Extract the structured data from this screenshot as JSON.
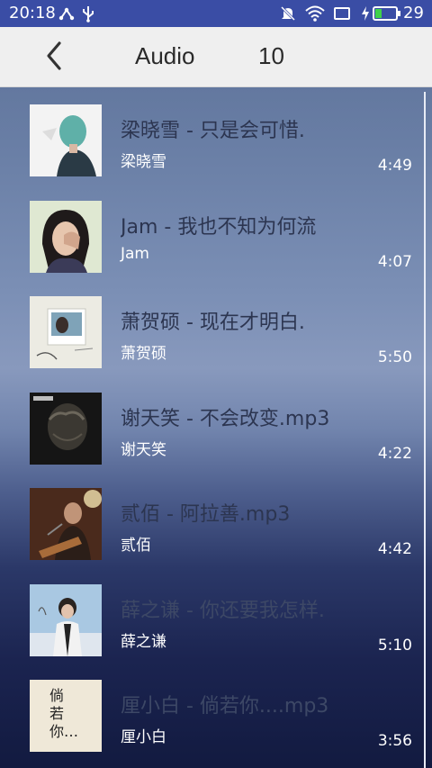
{
  "status_bar": {
    "time": "20:18",
    "battery": "29",
    "icons": [
      "usb-tether-icon",
      "usb-icon",
      "mute-icon",
      "wifi-icon",
      "screen-icon",
      "charging-icon",
      "battery-icon"
    ]
  },
  "toolbar": {
    "title": "Audio",
    "count": "10"
  },
  "songs": [
    {
      "title": "梁晓雪 - 只是会可惜.",
      "artist": "梁晓雪",
      "duration": "4:49"
    },
    {
      "title": "Jam - 我也不知为何流",
      "artist": "Jam",
      "duration": "4:07"
    },
    {
      "title": "萧贺硕 - 现在才明白.",
      "artist": "萧贺硕",
      "duration": "5:50"
    },
    {
      "title": "谢天笑 - 不会改变.mp3",
      "artist": "谢天笑",
      "duration": "4:22"
    },
    {
      "title": "贰佰 - 阿拉善.mp3",
      "artist": "贰佰",
      "duration": "4:42"
    },
    {
      "title": "薛之谦 - 你还要我怎样.",
      "artist": "薛之谦",
      "duration": "5:10"
    },
    {
      "title": "厘小白 - 倘若你....mp3",
      "artist": "厘小白",
      "duration": "3:56"
    }
  ],
  "covers": [
    {
      "cover_text": ""
    },
    {
      "cover_text": ""
    },
    {
      "cover_text": ""
    },
    {
      "cover_text": ""
    },
    {
      "cover_text": ""
    },
    {
      "cover_text": ""
    },
    {
      "cover_text": "倘若你…"
    }
  ]
}
